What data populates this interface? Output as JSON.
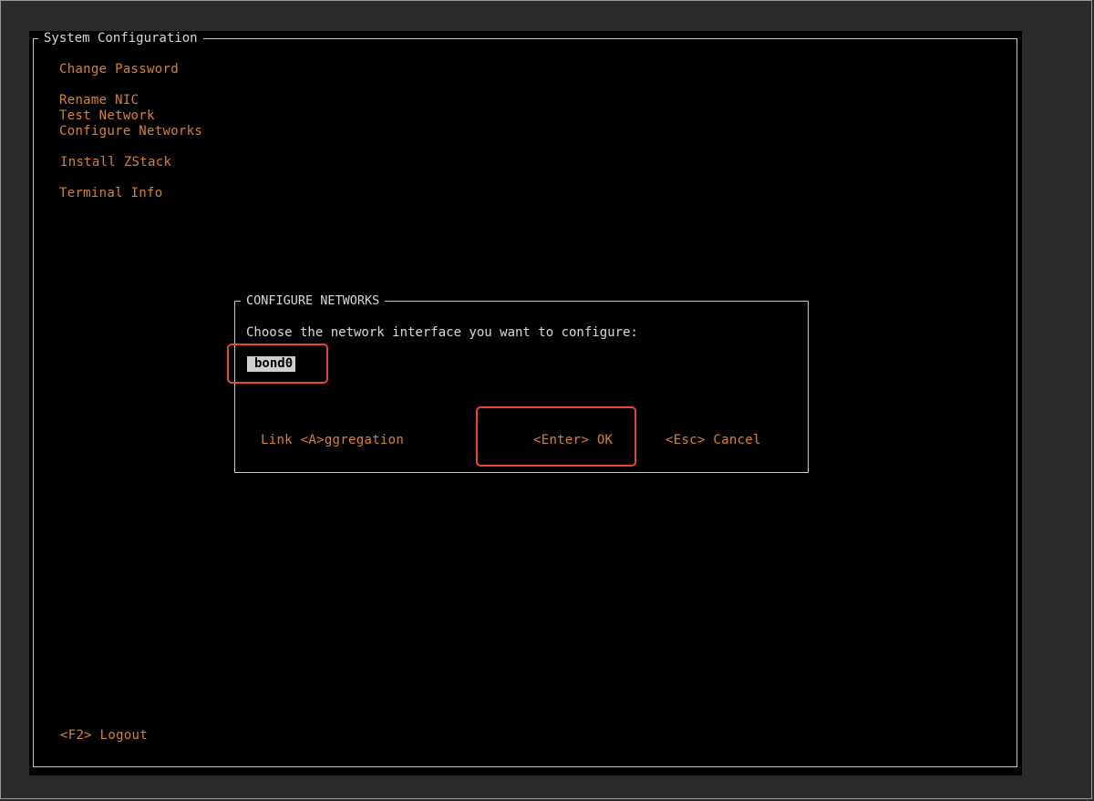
{
  "screen": {
    "title": "System Configuration",
    "menu": [
      {
        "label": "Change Password"
      },
      {
        "label": "Rename NIC"
      },
      {
        "label": "Test Network"
      },
      {
        "label": "Configure Networks"
      },
      {
        "label": "Install ZStack"
      },
      {
        "label": "Terminal Info"
      }
    ],
    "logout_label": "<F2> Logout"
  },
  "dialog": {
    "title": "CONFIGURE NETWORKS",
    "prompt": "Choose the network interface you want to configure:",
    "interface": "bond0",
    "link_aggregation_label": "Link <A>ggregation",
    "ok_label": "<Enter> OK",
    "cancel_label": "<Esc> Cancel"
  },
  "colors": {
    "background": "#000000",
    "menu_text": "#d9822b",
    "border": "#c8c8c8",
    "annotation": "#e8472a"
  }
}
